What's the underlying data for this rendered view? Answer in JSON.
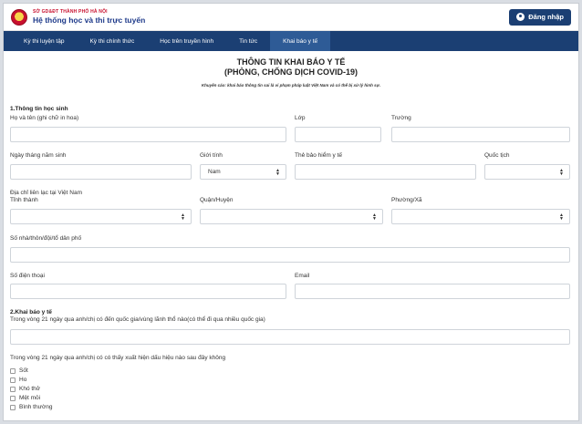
{
  "header": {
    "org_name": "SỞ GD&ĐT THÀNH PHỐ HÀ NỘI",
    "system_name": "Hệ thống học và thi trực tuyến",
    "login_label": "Đăng nhập"
  },
  "nav": {
    "items": [
      {
        "label": "Kỳ thi luyện tập"
      },
      {
        "label": "Kỳ thi chính thức"
      },
      {
        "label": "Học trên truyền hình"
      },
      {
        "label": "Tin tức"
      },
      {
        "label": "Khai báo y tế"
      }
    ]
  },
  "form": {
    "title_line1": "THÔNG TIN KHAI BÁO Y TẾ",
    "title_line2": "(PHÒNG, CHỐNG DỊCH COVID-19)",
    "note": "Khuyến cáo: khai báo thông tin sai là vi phạm pháp luật Việt Nam và có thể bị xử lý hình sự.",
    "section1": "1.Thông tin học sinh",
    "labels": {
      "full_name": "Họ và tên (ghi chữ in hoa)",
      "class": "Lớp",
      "school": "Trường",
      "dob": "Ngày tháng năm sinh",
      "gender": "Giới tính",
      "insurance": "Thẻ bảo hiểm y tế",
      "nationality": "Quốc tịch",
      "address": "Địa chỉ liên lạc tại Việt Nam",
      "province": "Tỉnh thành",
      "district": "Quận/Huyện",
      "ward": "Phường/Xã",
      "street": "Số nhà/thôn/đội/tổ dân phố",
      "phone": "Số điện thoại",
      "email": "Email"
    },
    "gender_value": "Nam",
    "section2": "2.Khai báo y tế",
    "q1": "Trong vòng 21 ngày qua anh/chị có đến quốc gia/vùng lãnh thổ nào(có thể đi qua nhiều quốc gia)",
    "q2": "Trong vòng 21 ngày qua anh/chị có có thấy xuất hiện dấu hiệu nào sau đây không",
    "symptoms": [
      "Sốt",
      "Ho",
      "Khó thở",
      "Mệt mỏi",
      "Bình thường"
    ]
  }
}
